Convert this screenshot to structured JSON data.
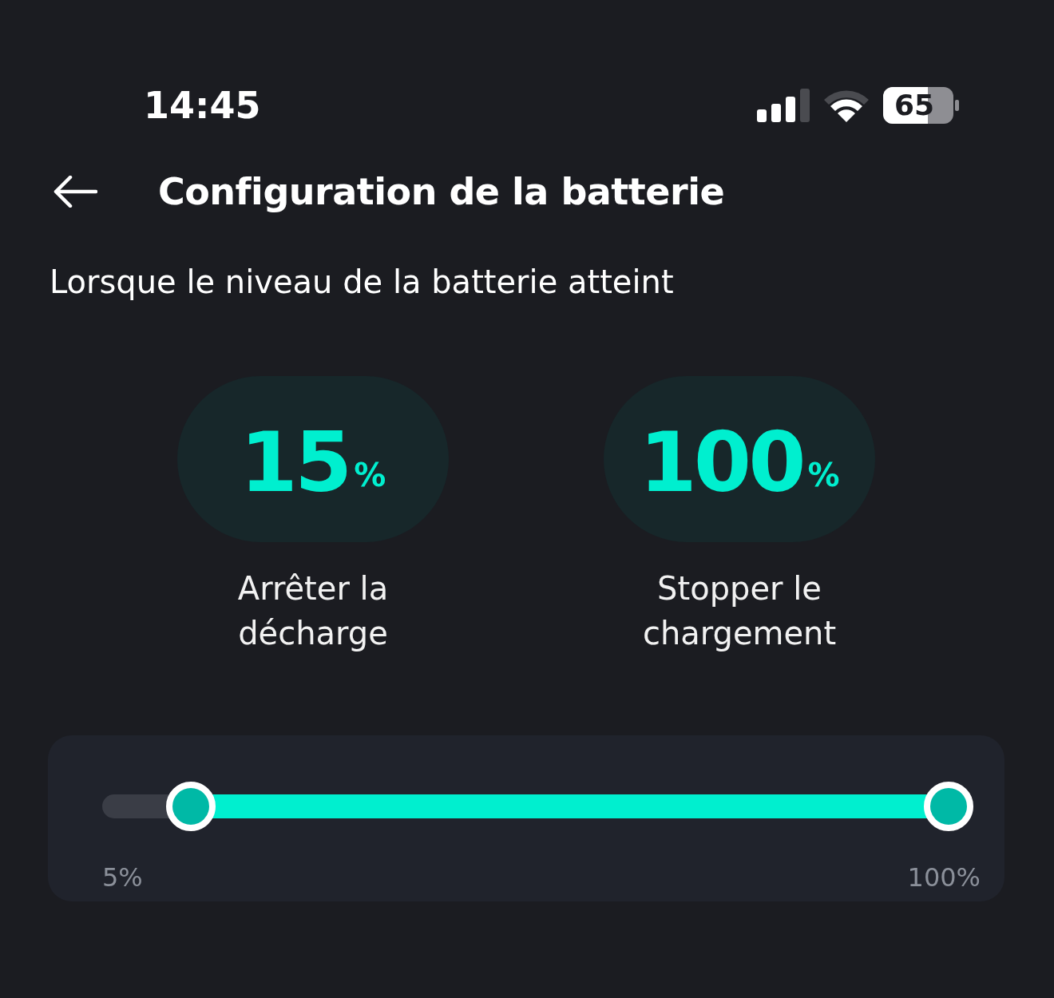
{
  "status_bar": {
    "time": "14:45",
    "battery": "65"
  },
  "header": {
    "title": "Configuration de la batterie"
  },
  "subtitle": "Lorsque le niveau de la batterie atteint",
  "limits": [
    {
      "value": "15",
      "unit": "%",
      "label": "Arrêter la décharge"
    },
    {
      "value": "100",
      "unit": "%",
      "label": "Stopper le chargement"
    }
  ],
  "slider": {
    "min_label": "5%",
    "max_label": "100%",
    "thumbs": [
      {
        "level": 0.105
      },
      {
        "level": 1
      }
    ]
  }
}
